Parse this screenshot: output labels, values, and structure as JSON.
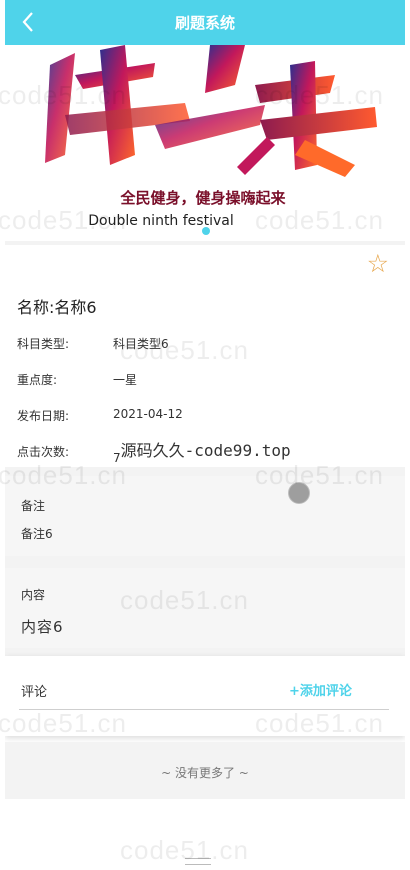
{
  "header": {
    "title": "刷题系统",
    "back_icon": "chevron-left-icon"
  },
  "banner": {
    "art_text": "健身",
    "slogan": "全民健身，健身操嗨起来",
    "subtitle": "Double ninth festival"
  },
  "detail": {
    "name_label": "名称:",
    "name_value": "名称6",
    "rows": [
      {
        "label": "科目类型:",
        "value": "科目类型6"
      },
      {
        "label": "重点度:",
        "value": "一星"
      },
      {
        "label": "发布日期:",
        "value": "2021-04-12"
      },
      {
        "label": "点击次数:",
        "value": "7",
        "extra": "源码久久-code99.top"
      }
    ],
    "favorite_icon": "star-outline-icon"
  },
  "notes": {
    "label": "备注",
    "value": "备注6"
  },
  "content": {
    "label": "内容",
    "value": "内容6"
  },
  "comment": {
    "label": "评论",
    "add_label": "+添加评论"
  },
  "footer": {
    "no_more": "~ 没有更多了 ~"
  },
  "watermark": "code51.cn",
  "colors": {
    "accent": "#4fd3ea",
    "star": "#e7a74e"
  }
}
